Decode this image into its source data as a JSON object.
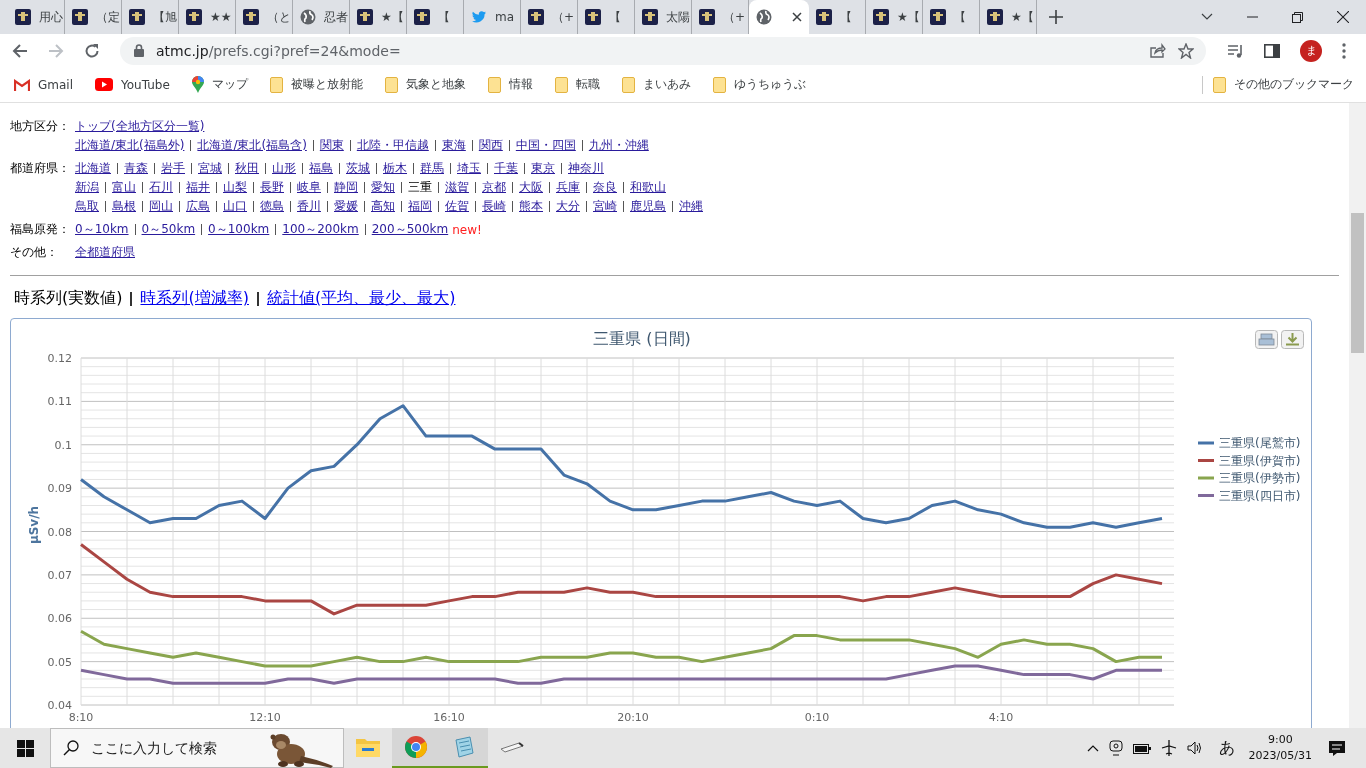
{
  "browser": {
    "tabs": [
      {
        "title": "用心",
        "kind": "site",
        "selected": false
      },
      {
        "title": "（定",
        "kind": "site",
        "selected": false
      },
      {
        "title": "【旭",
        "kind": "site",
        "selected": false
      },
      {
        "title": "★★",
        "kind": "site",
        "selected": false
      },
      {
        "title": "（と",
        "kind": "site",
        "selected": false
      },
      {
        "title": "忍者",
        "kind": "globe",
        "selected": false
      },
      {
        "title": "★【",
        "kind": "site",
        "selected": false
      },
      {
        "title": "【",
        "kind": "site",
        "selected": false
      },
      {
        "title": "ma",
        "kind": "bird",
        "selected": false
      },
      {
        "title": "（+",
        "kind": "site",
        "selected": false
      },
      {
        "title": "【",
        "kind": "site",
        "selected": false
      },
      {
        "title": "太陽",
        "kind": "site",
        "selected": false
      },
      {
        "title": "（+",
        "kind": "site",
        "selected": false
      },
      {
        "kind": "globe",
        "selected": true
      },
      {
        "title": "【",
        "kind": "site",
        "selected": false
      },
      {
        "title": "★【",
        "kind": "site",
        "selected": false
      },
      {
        "title": "【",
        "kind": "site",
        "selected": false
      },
      {
        "title": "★【",
        "kind": "site",
        "selected": false
      }
    ],
    "url_host": "atmc.jp",
    "url_path": "/prefs.cgi?pref=24&mode=",
    "profile": "ま",
    "bookmarks": [
      {
        "label": "Gmail",
        "kind": "gmail"
      },
      {
        "label": "YouTube",
        "kind": "youtube"
      },
      {
        "label": "マップ",
        "kind": "maps"
      },
      {
        "label": "被曝と放射能",
        "kind": "folder"
      },
      {
        "label": "気象と地象",
        "kind": "folder"
      },
      {
        "label": "情報",
        "kind": "folder"
      },
      {
        "label": "転職",
        "kind": "folder"
      },
      {
        "label": "まいあみ",
        "kind": "folder"
      },
      {
        "label": "ゆうちゅうぶ",
        "kind": "folder"
      }
    ],
    "other_bookmarks": "その他のブックマーク"
  },
  "nav": [
    {
      "label": "地方区分：",
      "lines": [
        [
          {
            "label": "トップ(全地方区分一覧)",
            "selected": false
          }
        ],
        [
          {
            "label": "北海道/東北(福島外)",
            "selected": false
          },
          {
            "label": "北海道/東北(福島含)",
            "selected": false
          },
          {
            "label": "関東",
            "selected": false
          },
          {
            "label": "北陸・甲信越",
            "selected": false
          },
          {
            "label": "東海",
            "selected": false
          },
          {
            "label": "関西",
            "selected": false
          },
          {
            "label": "中国・四国",
            "selected": false
          },
          {
            "label": "九州・沖縄",
            "selected": false
          }
        ]
      ]
    },
    {
      "label": "都道府県：",
      "lines": [
        [
          {
            "label": "北海道",
            "selected": false
          },
          {
            "label": "青森",
            "selected": false
          },
          {
            "label": "岩手",
            "selected": false
          },
          {
            "label": "宮城",
            "selected": false
          },
          {
            "label": "秋田",
            "selected": false
          },
          {
            "label": "山形",
            "selected": false
          },
          {
            "label": "福島",
            "selected": false
          },
          {
            "label": "茨城",
            "selected": false
          },
          {
            "label": "栃木",
            "selected": false
          },
          {
            "label": "群馬",
            "selected": false
          },
          {
            "label": "埼玉",
            "selected": false
          },
          {
            "label": "千葉",
            "selected": false
          },
          {
            "label": "東京",
            "selected": false
          },
          {
            "label": "神奈川",
            "selected": false
          }
        ],
        [
          {
            "label": "新潟",
            "selected": false
          },
          {
            "label": "富山",
            "selected": false
          },
          {
            "label": "石川",
            "selected": false
          },
          {
            "label": "福井",
            "selected": false
          },
          {
            "label": "山梨",
            "selected": false
          },
          {
            "label": "長野",
            "selected": false
          },
          {
            "label": "岐阜",
            "selected": false
          },
          {
            "label": "静岡",
            "selected": false
          },
          {
            "label": "愛知",
            "selected": false
          },
          {
            "label": "三重",
            "selected": true
          },
          {
            "label": "滋賀",
            "selected": false
          },
          {
            "label": "京都",
            "selected": false
          },
          {
            "label": "大阪",
            "selected": false
          },
          {
            "label": "兵庫",
            "selected": false
          },
          {
            "label": "奈良",
            "selected": false
          },
          {
            "label": "和歌山",
            "selected": false
          }
        ],
        [
          {
            "label": "鳥取",
            "selected": false
          },
          {
            "label": "島根",
            "selected": false
          },
          {
            "label": "岡山",
            "selected": false
          },
          {
            "label": "広島",
            "selected": false
          },
          {
            "label": "山口",
            "selected": false
          },
          {
            "label": "徳島",
            "selected": false
          },
          {
            "label": "香川",
            "selected": false
          },
          {
            "label": "愛媛",
            "selected": false
          },
          {
            "label": "高知",
            "selected": false
          },
          {
            "label": "福岡",
            "selected": false
          },
          {
            "label": "佐賀",
            "selected": false
          },
          {
            "label": "長崎",
            "selected": false
          },
          {
            "label": "熊本",
            "selected": false
          },
          {
            "label": "大分",
            "selected": false
          },
          {
            "label": "宮崎",
            "selected": false
          },
          {
            "label": "鹿児島",
            "selected": false
          },
          {
            "label": "沖縄",
            "selected": false
          }
        ]
      ]
    },
    {
      "label": "福島原発：",
      "badge": "new!",
      "lines": [
        [
          {
            "label": "0～10km",
            "selected": false
          },
          {
            "label": "0～50km",
            "selected": false
          },
          {
            "label": "0～100km",
            "selected": false
          },
          {
            "label": "100～200km",
            "selected": false
          },
          {
            "label": "200～500km",
            "selected": false
          }
        ]
      ]
    },
    {
      "label": "その他：",
      "lines": [
        [
          {
            "label": "全都道府県",
            "selected": false
          }
        ]
      ]
    }
  ],
  "views": [
    {
      "label": "時系列(実数値)",
      "selected": true
    },
    {
      "label": "時系列(増減率)",
      "selected": false
    },
    {
      "label": "統計値(平均、最少、最大)",
      "selected": false
    }
  ],
  "chart": {
    "chart_data": {
      "type": "line",
      "title": "三重県 (日間)",
      "ylabel": "μSv/h",
      "categories": [
        "8:10",
        null,
        null,
        null,
        null,
        null,
        null,
        null,
        "12:10",
        null,
        null,
        null,
        null,
        null,
        null,
        null,
        "16:10",
        null,
        null,
        null,
        null,
        null,
        null,
        null,
        "20:10",
        null,
        null,
        null,
        null,
        null,
        null,
        null,
        "0:10",
        null,
        null,
        null,
        null,
        null,
        null,
        null,
        "4:10",
        null,
        null,
        null,
        null,
        null,
        null,
        null
      ],
      "grid": true,
      "legend": "right",
      "ylim": [
        0.04,
        0.12
      ],
      "yticks": [
        0.04,
        0.05,
        0.06,
        0.07,
        0.08,
        0.09,
        0.1,
        0.11,
        0.12
      ],
      "series": [
        {
          "name": "三重県(尾鷲市)",
          "color": "#4572a7",
          "values": [
            0.092,
            0.088,
            0.085,
            0.082,
            0.083,
            0.083,
            0.086,
            0.087,
            0.083,
            0.09,
            0.094,
            0.095,
            0.1,
            0.106,
            0.109,
            0.102,
            0.102,
            0.102,
            0.099,
            0.099,
            0.099,
            0.093,
            0.091,
            0.087,
            0.085,
            0.085,
            0.086,
            0.087,
            0.087,
            0.088,
            0.089,
            0.087,
            0.086,
            0.087,
            0.083,
            0.082,
            0.083,
            0.086,
            0.087,
            0.085,
            0.084,
            0.082,
            0.081,
            0.081,
            0.082,
            0.081,
            0.082,
            0.083
          ]
        },
        {
          "name": "三重県(伊賀市)",
          "color": "#aa4643",
          "values": [
            0.077,
            0.073,
            0.069,
            0.066,
            0.065,
            0.065,
            0.065,
            0.065,
            0.064,
            0.064,
            0.064,
            0.061,
            0.063,
            0.063,
            0.063,
            0.063,
            0.064,
            0.065,
            0.065,
            0.066,
            0.066,
            0.066,
            0.067,
            0.066,
            0.066,
            0.065,
            0.065,
            0.065,
            0.065,
            0.065,
            0.065,
            0.065,
            0.065,
            0.065,
            0.064,
            0.065,
            0.065,
            0.066,
            0.067,
            0.066,
            0.065,
            0.065,
            0.065,
            0.065,
            0.068,
            0.07,
            0.069,
            0.068
          ]
        },
        {
          "name": "三重県(伊勢市)",
          "color": "#89a54e",
          "values": [
            0.057,
            0.054,
            0.053,
            0.052,
            0.051,
            0.052,
            0.051,
            0.05,
            0.049,
            0.049,
            0.049,
            0.05,
            0.051,
            0.05,
            0.05,
            0.051,
            0.05,
            0.05,
            0.05,
            0.05,
            0.051,
            0.051,
            0.051,
            0.052,
            0.052,
            0.051,
            0.051,
            0.05,
            0.051,
            0.052,
            0.053,
            0.056,
            0.056,
            0.055,
            0.055,
            0.055,
            0.055,
            0.054,
            0.053,
            0.051,
            0.054,
            0.055,
            0.054,
            0.054,
            0.053,
            0.05,
            0.051,
            0.051
          ]
        },
        {
          "name": "三重県(四日市)",
          "color": "#80699b",
          "values": [
            0.048,
            0.047,
            0.046,
            0.046,
            0.045,
            0.045,
            0.045,
            0.045,
            0.045,
            0.046,
            0.046,
            0.045,
            0.046,
            0.046,
            0.046,
            0.046,
            0.046,
            0.046,
            0.046,
            0.045,
            0.045,
            0.046,
            0.046,
            0.046,
            0.046,
            0.046,
            0.046,
            0.046,
            0.046,
            0.046,
            0.046,
            0.046,
            0.046,
            0.046,
            0.046,
            0.046,
            0.047,
            0.048,
            0.049,
            0.049,
            0.048,
            0.047,
            0.047,
            0.047,
            0.046,
            0.048,
            0.048,
            0.048
          ]
        }
      ]
    }
  },
  "taskbar": {
    "search_placeholder": "ここに入力して検索",
    "apps": [
      {
        "kind": "folder",
        "running": false
      },
      {
        "kind": "chrome",
        "running": true
      },
      {
        "kind": "notepad",
        "running": true
      },
      {
        "kind": "usb",
        "running": false
      }
    ],
    "ime": "あ",
    "time": "9:00",
    "date": "2023/05/31"
  }
}
